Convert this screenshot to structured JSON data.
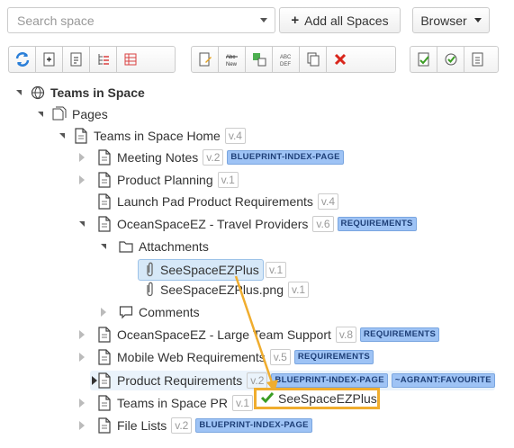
{
  "search": {
    "placeholder": "Search space"
  },
  "header": {
    "add_all_label": "Add all Spaces",
    "browser_label": "Browser"
  },
  "toolbar": {
    "group1": [
      "refresh-icon",
      "add-page-icon",
      "page-icon",
      "tree-icon",
      "tree-grid-icon"
    ],
    "group2": [
      "edit-page-icon",
      "rename-icon",
      "move-icon",
      "abc-def-icon",
      "copy-icon",
      "delete-icon"
    ],
    "group3": [
      "approve-icon",
      "refresh-check-icon",
      "document-icon"
    ]
  },
  "tree": {
    "space": "Teams in Space",
    "pages_folder": "Pages",
    "home": {
      "label": "Teams in Space Home",
      "version": "v.4"
    },
    "meeting_notes": {
      "label": "Meeting Notes",
      "version": "v.2",
      "badges": [
        "BLUEPRINT-INDEX-PAGE"
      ]
    },
    "product_planning": {
      "label": "Product Planning",
      "version": "v.1"
    },
    "launch_pad": {
      "label": "Launch Pad Product Requirements",
      "version": "v.4"
    },
    "oceanspace_travel": {
      "label": "OceanSpaceEZ - Travel Providers",
      "version": "v.6",
      "badges": [
        "REQUIREMENTS"
      ]
    },
    "attachments": "Attachments",
    "attachment1": {
      "label": "SeeSpaceEZPlus",
      "version": "v.1"
    },
    "attachment2": {
      "label": "SeeSpaceEZPlus.png",
      "version": "v.1"
    },
    "comments": "Comments",
    "oceanspace_large": {
      "label": "OceanSpaceEZ - Large Team Support",
      "version": "v.8",
      "badges": [
        "REQUIREMENTS"
      ]
    },
    "mobile_web": {
      "label": "Mobile Web Requirements",
      "version": "v.5",
      "badges": [
        "REQUIREMENTS"
      ]
    },
    "product_requirements": {
      "label": "Product Requirements",
      "version": "v.2",
      "badges": [
        "BLUEPRINT-INDEX-PAGE",
        "~AGRANT:FAVOURITE"
      ]
    },
    "teams_pr": {
      "label": "Teams in Space PR",
      "version": "v.1"
    },
    "file_lists": {
      "label": "File Lists",
      "version": "v.2",
      "badges": [
        "BLUEPRINT-INDEX-PAGE"
      ]
    }
  },
  "drag": {
    "label": "SeeSpaceEZPlus",
    "accent": "#f0ad2e",
    "check_color": "#3a9d23"
  }
}
